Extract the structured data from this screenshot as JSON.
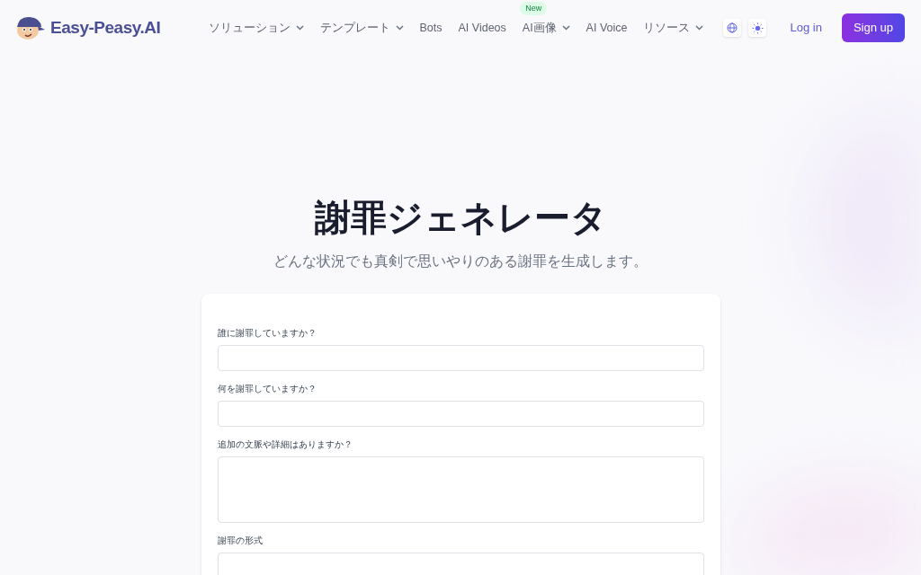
{
  "header": {
    "logo_text": "Easy-Peasy.AI",
    "nav": [
      {
        "label": "ソリューション",
        "dropdown": true
      },
      {
        "label": "テンプレート",
        "dropdown": true
      },
      {
        "label": "Bots",
        "dropdown": false
      },
      {
        "label": "AI Videos",
        "dropdown": false
      },
      {
        "label": "AI画像",
        "dropdown": true,
        "badge": "New"
      },
      {
        "label": "AI Voice",
        "dropdown": false
      },
      {
        "label": "リソース",
        "dropdown": true
      }
    ],
    "login": "Log in",
    "signup": "Sign up"
  },
  "hero": {
    "title": "謝罪ジェネレータ",
    "subtitle": "どんな状況でも真剣で思いやりのある謝罪を生成します。"
  },
  "form": {
    "fields": [
      {
        "label": "誰に謝罪していますか？",
        "kind": "input"
      },
      {
        "label": "何を謝罪していますか？",
        "kind": "input"
      },
      {
        "label": "追加の文脈や詳細はありますか？",
        "kind": "textarea"
      },
      {
        "label": "謝罪の形式",
        "kind": "input"
      }
    ]
  }
}
